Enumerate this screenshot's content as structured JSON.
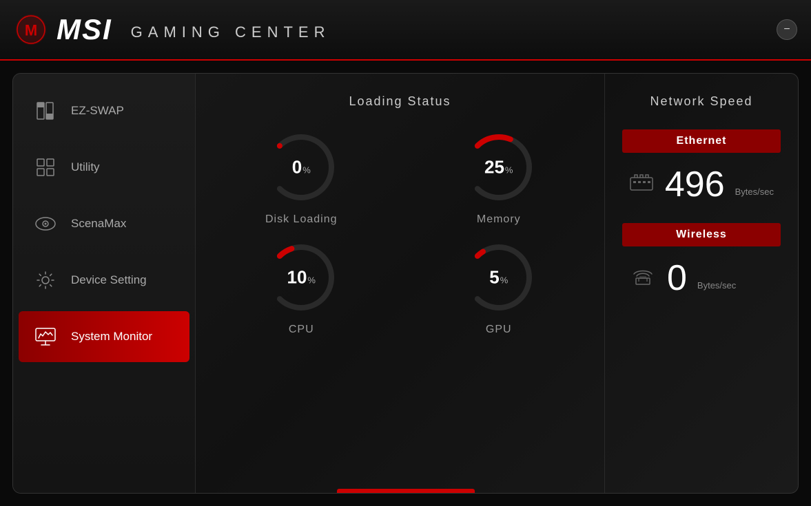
{
  "titleBar": {
    "appName": "MSI",
    "subtitle": "GAMING CENTER",
    "minimizeLabel": "−"
  },
  "sidebar": {
    "items": [
      {
        "id": "ez-swap",
        "label": "EZ-SWAP",
        "icon": "grid-icon",
        "active": false
      },
      {
        "id": "utility",
        "label": "Utility",
        "icon": "apps-icon",
        "active": false
      },
      {
        "id": "scenamax",
        "label": "ScenaMax",
        "icon": "eye-icon",
        "active": false
      },
      {
        "id": "device-setting",
        "label": "Device Setting",
        "icon": "gear-icon",
        "active": false
      },
      {
        "id": "system-monitor",
        "label": "System Monitor",
        "icon": "monitor-icon",
        "active": true
      }
    ]
  },
  "loadingStatus": {
    "title": "Loading Status",
    "gauges": [
      {
        "id": "disk",
        "value": "0",
        "unit": "%",
        "label": "Disk Loading",
        "percent": 0
      },
      {
        "id": "memory",
        "value": "25",
        "unit": "%",
        "label": "Memory",
        "percent": 25
      },
      {
        "id": "cpu",
        "value": "10",
        "unit": "%",
        "label": "CPU",
        "percent": 10
      },
      {
        "id": "gpu",
        "value": "5",
        "unit": "%",
        "label": "GPU",
        "percent": 5
      }
    ]
  },
  "networkSpeed": {
    "title": "Network Speed",
    "ethernet": {
      "label": "Ethernet",
      "value": "496",
      "unit": "Bytes/sec"
    },
    "wireless": {
      "label": "Wireless",
      "value": "0",
      "unit": "Bytes/sec"
    }
  },
  "colors": {
    "accent": "#cc0000",
    "darkAccent": "#8b0000",
    "bg": "#111111",
    "sidebar": "#1c1c1c"
  }
}
